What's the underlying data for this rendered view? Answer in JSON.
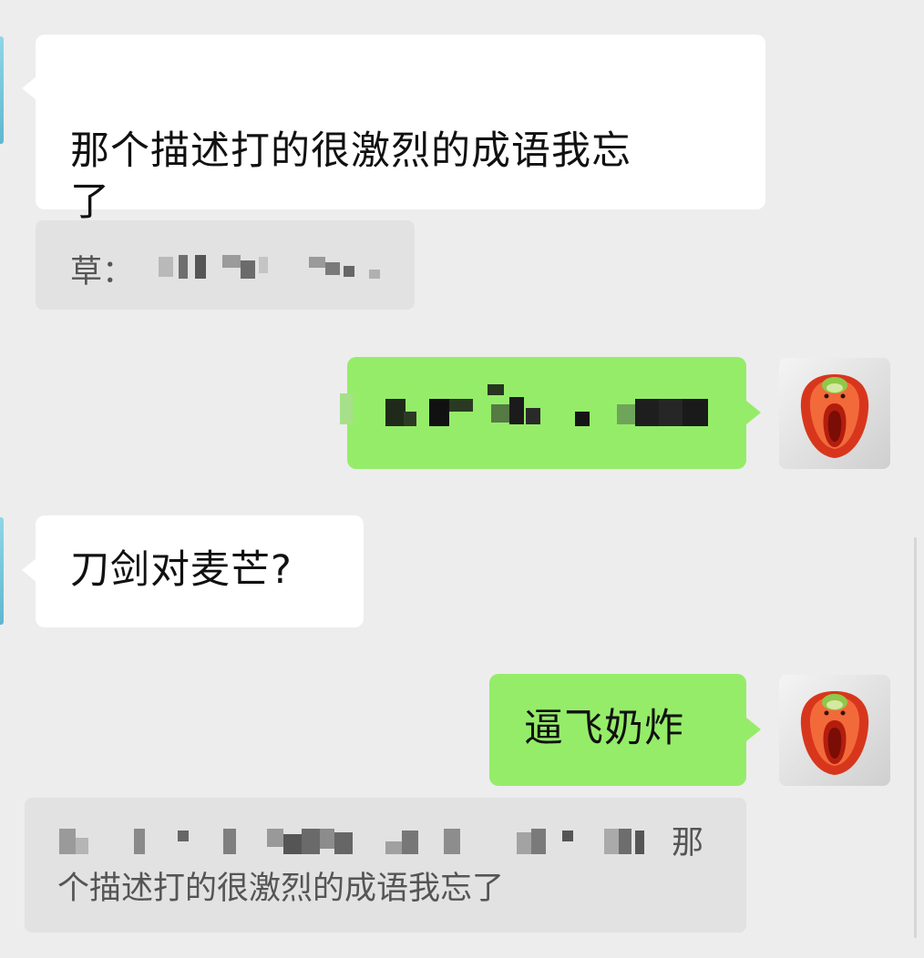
{
  "chat": {
    "messages": [
      {
        "direction": "incoming",
        "text": "那个描述打的很激烈的成语我忘\n了"
      },
      {
        "direction": "incoming-quote",
        "prefix": "草："
      },
      {
        "direction": "outgoing",
        "content": "pixelated"
      },
      {
        "direction": "incoming",
        "text": "刀剑对麦芒?"
      },
      {
        "direction": "outgoing",
        "text": "逼飞奶炸"
      },
      {
        "direction": "outgoing-quote",
        "text_start": "那",
        "text_rest": "个描述打的很激烈的成语我忘了"
      }
    ]
  },
  "avatar": {
    "icon": "bell-pepper-face-icon"
  },
  "colors": {
    "background": "#ededed",
    "incoming_bubble": "#ffffff",
    "outgoing_bubble": "#95ec69",
    "quote_box": "#e2e2e2",
    "quote_text": "#555555"
  }
}
